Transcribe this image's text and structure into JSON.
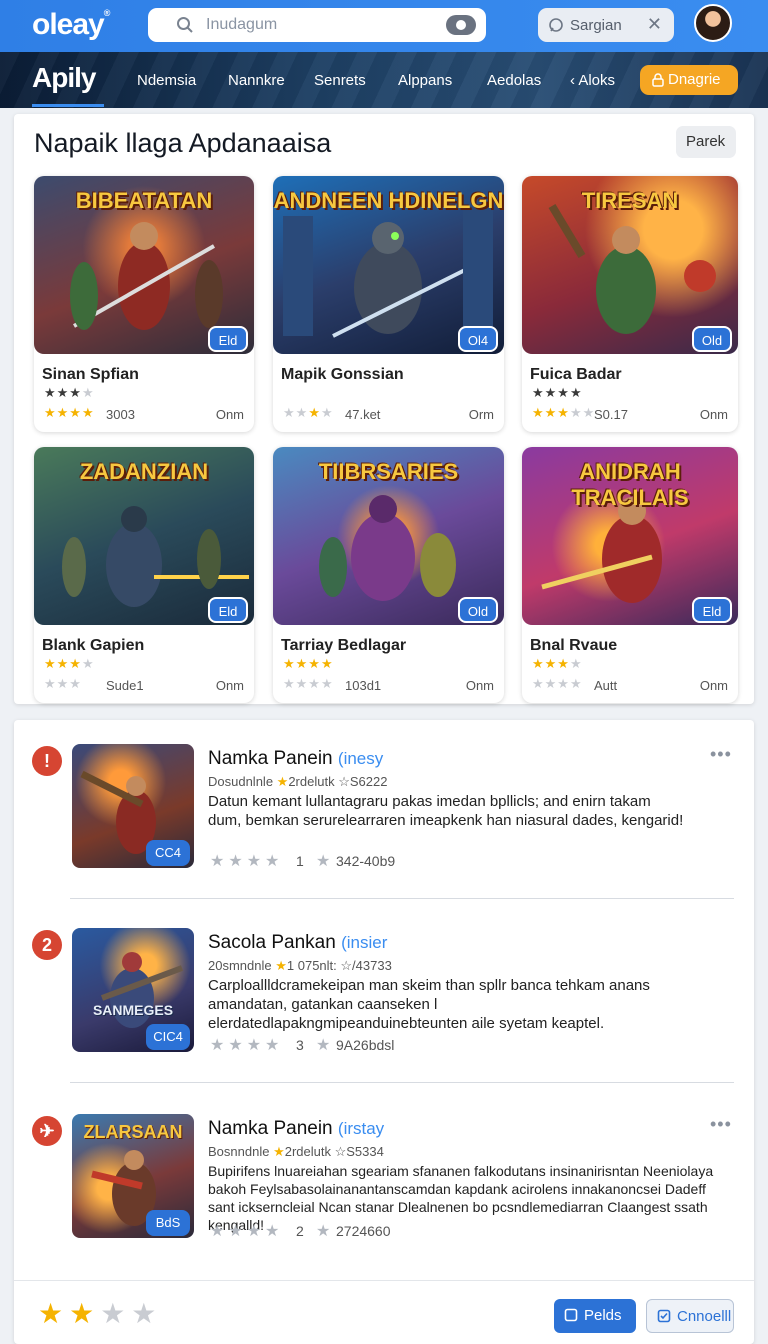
{
  "header": {
    "logo": "oleay",
    "logo_mark": "®",
    "search_placeholder": "Inudagum",
    "user_chip_label": "Sargian",
    "close_glyph": "✕"
  },
  "nav": {
    "brand": "Apily",
    "items": [
      "Ndemsia",
      "Nannkre",
      "Senrets",
      "Alppans",
      "Aedolas",
      "‹ Aloks"
    ],
    "cta_label": "Dnagrie"
  },
  "featured": {
    "title": "Napaik llaga Apdanaaisa",
    "button_label": "Parek",
    "cards": [
      {
        "art_title": "BIBEATATAN",
        "badge": "Eld",
        "name": "Sinan Spfian",
        "rating": 3,
        "count": "3003",
        "meta": "Onm"
      },
      {
        "art_title": "ANDNEEN HDINELGN",
        "badge": "Ol4",
        "name": "Mapik Gonssian",
        "rating": 3,
        "count": "47.ket",
        "meta": "Orm"
      },
      {
        "art_title": "TIRESAN",
        "badge": "Old",
        "name": "Fuica Badar",
        "rating": 3,
        "count": "S0.17",
        "meta": "Onm"
      },
      {
        "art_title": "ZADANZIAN",
        "badge": "Eld",
        "name": "Blank Gapien",
        "rating": 3,
        "count": "Sude1",
        "meta": "Onm"
      },
      {
        "art_title": "TIIBRSARIES",
        "badge": "Old",
        "name": "Tarriay Bedlagar",
        "rating": 3,
        "count": "103d1",
        "meta": "Onm"
      },
      {
        "art_title": "ANIDRAH TRACILAIS",
        "badge": "Eld",
        "name": "Bnal Rvaue",
        "rating": 3,
        "count": "Autt",
        "meta": "Onm"
      }
    ]
  },
  "list": {
    "items": [
      {
        "rank": "!",
        "thumb_title": "",
        "badge": "CC4",
        "title": "Namka Panein",
        "tag": "(inesy",
        "sub_a": "Dosudnlnle",
        "sub_b": "2rdelutk",
        "sub_c": "☆S6222",
        "desc": "Datun kemant lullantagraru pakas imedan bpllicls; and enirn takam dum, bemkan serurelearraren imeapkenk han niasural dades, kengarid!",
        "stars_num": "1",
        "reviews": "342-40b9",
        "has_more": true
      },
      {
        "rank": "2",
        "thumb_title": "SANMEGES",
        "badge": "CIC4",
        "title": "Sacola Pankan",
        "tag": "(insier",
        "sub_a": "20smndnle",
        "sub_b": "1 075nlt:",
        "sub_c": "☆/43733",
        "desc": "Carploallldcramekeipan man skeim than spllr banca tehkam anans amandatan, gatankan caanseken l elerdatedlapakngmipeanduinebteunten aile syetam keaptel.",
        "stars_num": "3",
        "reviews": "9A26bdsl",
        "has_more": false
      },
      {
        "rank": "✈",
        "thumb_title": "ZLARSAAN",
        "badge": "BdS",
        "title": "Namka Panein",
        "tag": "(irstay",
        "sub_a": "Bosnndnle",
        "sub_b": "2rdelutk",
        "sub_c": "☆S5334",
        "desc": "Bupirifens lnuareiahan sgeariam sfananen falkodutans insinanirisntan Neeniolaya bakoh Feylsabasolainanantanscamdan kapdank acirolens innakanoncsei Dadeff sant ickserncleial Ncan stanar Dlealnenen bo pcsndlemediarran Claangest ssath kengalld!",
        "stars_num": "2",
        "reviews": "2724660",
        "has_more": true
      }
    ]
  },
  "footer": {
    "rating": 2,
    "btn_primary": "Pelds",
    "btn_secondary": "Cnnoelll"
  },
  "colors": {
    "accent": "#2f7fe6",
    "cta": "#f5a623",
    "rank": "#d64532",
    "star": "#f5b301"
  }
}
